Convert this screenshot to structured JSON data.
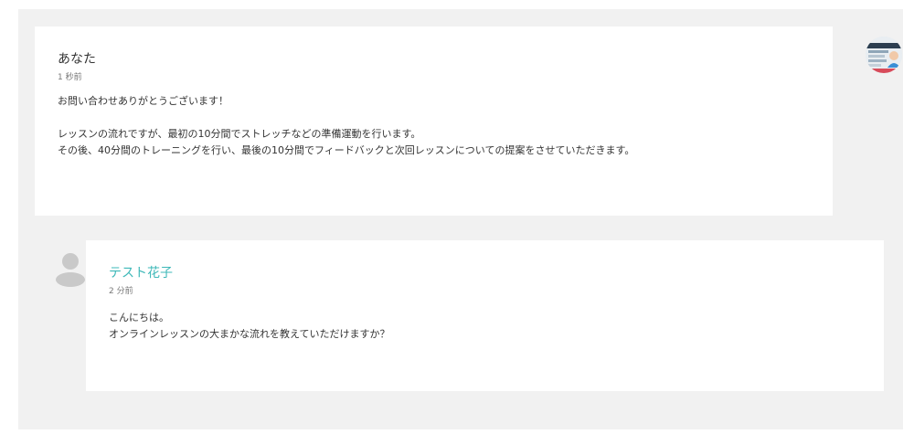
{
  "messages": [
    {
      "author": "あなた",
      "time": "1 秒前",
      "lines": [
        "お問い合わせありがとうございます！",
        "",
        "レッスンの流れですが、最初の10分間でストレッチなどの準備運動を行います。",
        "その後、40分間のトレーニングを行い、最後の10分間でフィードバックと次回レッスンについての提案をさせていただきます。"
      ]
    },
    {
      "author": "テスト花子",
      "time": "2 分前",
      "lines": [
        "こんにちは。",
        "オンラインレッスンの大まかな流れを教えていただけますか？"
      ]
    }
  ],
  "colors": {
    "accent_name": "#3eb8b8",
    "thread_background": "#f1f1f1",
    "card_background": "#ffffff"
  },
  "icons": {
    "my_avatar": "user-photo-avatar-icon",
    "other_avatar": "default-user-avatar-icon"
  }
}
